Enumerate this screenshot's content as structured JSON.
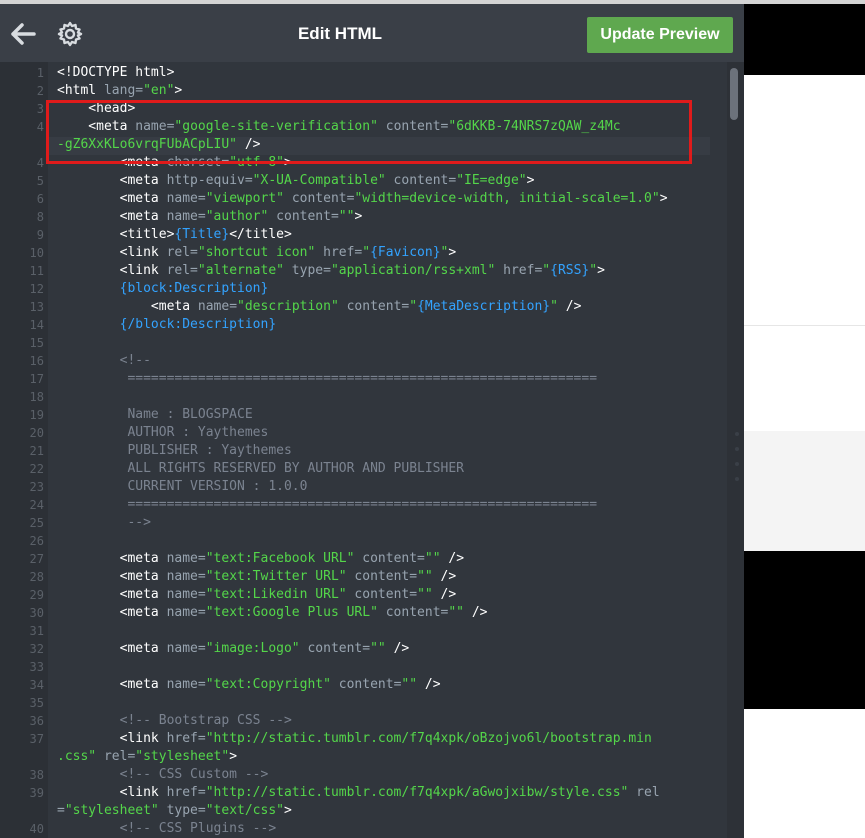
{
  "header": {
    "title": "Edit HTML",
    "update_button_label": "Update Preview",
    "back_icon": "left-arrow-icon",
    "settings_icon": "gear-icon"
  },
  "colors": {
    "editor_bg": "#3a3f47",
    "code_bg": "#31363d",
    "tag": "#ffffff",
    "attr": "#98a4b0",
    "string": "#54d64a",
    "placeholder": "#33a3ff",
    "comment": "#7b8390",
    "button_green": "#5fa84f",
    "highlight_red": "#e01b1b"
  },
  "editor": {
    "lines": [
      {
        "n": "1",
        "tokens": [
          [
            "t",
            "<!DOCTYPE html>"
          ]
        ]
      },
      {
        "n": "2",
        "tokens": [
          [
            "t",
            "<html "
          ],
          [
            "a",
            "lang="
          ],
          [
            "s",
            "\"en\""
          ],
          [
            "t",
            ">"
          ]
        ]
      },
      {
        "n": "3",
        "tokens": [
          [
            "t",
            "    <head>"
          ]
        ]
      },
      {
        "n": "4",
        "tokens": [
          [
            "t",
            "    <meta "
          ],
          [
            "a",
            "name="
          ],
          [
            "s",
            "\"google-site-verification\""
          ],
          [
            "a",
            " content="
          ],
          [
            "s",
            "\"6dKKB-74NRS7zQAW_z4Mc"
          ]
        ]
      },
      {
        "n": "",
        "tokens": [
          [
            "s",
            "-gZ6XxKLo6vrqFUbACpLIU\""
          ],
          [
            "t",
            " />"
          ]
        ]
      },
      {
        "n": "4",
        "tokens": [
          [
            "t",
            "        <meta "
          ],
          [
            "a",
            "charset="
          ],
          [
            "s",
            "\"utf-8\""
          ],
          [
            "t",
            ">"
          ]
        ]
      },
      {
        "n": "5",
        "tokens": [
          [
            "t",
            "        <meta "
          ],
          [
            "a",
            "http-equiv="
          ],
          [
            "s",
            "\"X-UA-Compatible\""
          ],
          [
            "a",
            " content="
          ],
          [
            "s",
            "\"IE=edge\""
          ],
          [
            "t",
            ">"
          ]
        ]
      },
      {
        "n": "6",
        "tokens": [
          [
            "t",
            "        <meta "
          ],
          [
            "a",
            "name="
          ],
          [
            "s",
            "\"viewport\""
          ],
          [
            "a",
            " content="
          ],
          [
            "s",
            "\"width=device-width, initial-scale=1.0\""
          ],
          [
            "t",
            ">"
          ]
        ]
      },
      {
        "n": "8",
        "tokens": [
          [
            "t",
            "        <meta "
          ],
          [
            "a",
            "name="
          ],
          [
            "s",
            "\"author\""
          ],
          [
            "a",
            " content="
          ],
          [
            "s",
            "\"\""
          ],
          [
            "t",
            ">"
          ]
        ]
      },
      {
        "n": "9",
        "tokens": [
          [
            "t",
            "        <title>"
          ],
          [
            "p",
            "{Title}"
          ],
          [
            "t",
            "</title>"
          ]
        ]
      },
      {
        "n": "10",
        "tokens": [
          [
            "t",
            "        <link "
          ],
          [
            "a",
            "rel="
          ],
          [
            "s",
            "\"shortcut icon\""
          ],
          [
            "a",
            " href="
          ],
          [
            "s",
            "\""
          ],
          [
            "p",
            "{Favicon}"
          ],
          [
            "s",
            "\""
          ],
          [
            "t",
            ">"
          ]
        ]
      },
      {
        "n": "11",
        "tokens": [
          [
            "t",
            "        <link "
          ],
          [
            "a",
            "rel="
          ],
          [
            "s",
            "\"alternate\""
          ],
          [
            "a",
            " type="
          ],
          [
            "s",
            "\"application/rss+xml\""
          ],
          [
            "a",
            " href="
          ],
          [
            "s",
            "\""
          ],
          [
            "p",
            "{RSS}"
          ],
          [
            "s",
            "\""
          ],
          [
            "t",
            ">"
          ]
        ]
      },
      {
        "n": "12",
        "tokens": [
          [
            "p",
            "        {block:Description}"
          ]
        ]
      },
      {
        "n": "13",
        "tokens": [
          [
            "t",
            "            <meta "
          ],
          [
            "a",
            "name="
          ],
          [
            "s",
            "\"description\""
          ],
          [
            "a",
            " content="
          ],
          [
            "s",
            "\""
          ],
          [
            "p",
            "{MetaDescription}"
          ],
          [
            "s",
            "\""
          ],
          [
            "t",
            " />"
          ]
        ]
      },
      {
        "n": "14",
        "tokens": [
          [
            "p",
            "        {/block:Description}"
          ]
        ]
      },
      {
        "n": "15",
        "tokens": []
      },
      {
        "n": "16",
        "tokens": [
          [
            "c",
            "        <!--"
          ]
        ]
      },
      {
        "n": "17",
        "tokens": [
          [
            "c",
            "         ============================================================"
          ]
        ]
      },
      {
        "n": "18",
        "tokens": []
      },
      {
        "n": "19",
        "tokens": [
          [
            "c",
            "         Name : BLOGSPACE"
          ]
        ]
      },
      {
        "n": "20",
        "tokens": [
          [
            "c",
            "         AUTHOR : Yaythemes"
          ]
        ]
      },
      {
        "n": "21",
        "tokens": [
          [
            "c",
            "         PUBLISHER : Yaythemes"
          ]
        ]
      },
      {
        "n": "22",
        "tokens": [
          [
            "c",
            "         ALL RIGHTS RESERVED BY AUTHOR AND PUBLISHER"
          ]
        ]
      },
      {
        "n": "23",
        "tokens": [
          [
            "c",
            "         CURRENT VERSION : 1.0.0"
          ]
        ]
      },
      {
        "n": "24",
        "tokens": [
          [
            "c",
            "         ============================================================"
          ]
        ]
      },
      {
        "n": "25",
        "tokens": [
          [
            "c",
            "         -->"
          ]
        ]
      },
      {
        "n": "26",
        "tokens": []
      },
      {
        "n": "27",
        "tokens": [
          [
            "t",
            "        <meta "
          ],
          [
            "a",
            "name="
          ],
          [
            "s",
            "\"text:Facebook URL\""
          ],
          [
            "a",
            " content="
          ],
          [
            "s",
            "\"\""
          ],
          [
            "t",
            " />"
          ]
        ]
      },
      {
        "n": "28",
        "tokens": [
          [
            "t",
            "        <meta "
          ],
          [
            "a",
            "name="
          ],
          [
            "s",
            "\"text:Twitter URL\""
          ],
          [
            "a",
            " content="
          ],
          [
            "s",
            "\"\""
          ],
          [
            "t",
            " />"
          ]
        ]
      },
      {
        "n": "29",
        "tokens": [
          [
            "t",
            "        <meta "
          ],
          [
            "a",
            "name="
          ],
          [
            "s",
            "\"text:Likedin URL\""
          ],
          [
            "a",
            " content="
          ],
          [
            "s",
            "\"\""
          ],
          [
            "t",
            " />"
          ]
        ]
      },
      {
        "n": "30",
        "tokens": [
          [
            "t",
            "        <meta "
          ],
          [
            "a",
            "name="
          ],
          [
            "s",
            "\"text:Google Plus URL\""
          ],
          [
            "a",
            " content="
          ],
          [
            "s",
            "\"\""
          ],
          [
            "t",
            " />"
          ]
        ]
      },
      {
        "n": "31",
        "tokens": []
      },
      {
        "n": "32",
        "tokens": [
          [
            "t",
            "        <meta "
          ],
          [
            "a",
            "name="
          ],
          [
            "s",
            "\"image:Logo\""
          ],
          [
            "a",
            " content="
          ],
          [
            "s",
            "\"\""
          ],
          [
            "t",
            " />"
          ]
        ]
      },
      {
        "n": "33",
        "tokens": []
      },
      {
        "n": "34",
        "tokens": [
          [
            "t",
            "        <meta "
          ],
          [
            "a",
            "name="
          ],
          [
            "s",
            "\"text:Copyright\""
          ],
          [
            "a",
            " content="
          ],
          [
            "s",
            "\"\""
          ],
          [
            "t",
            " />"
          ]
        ]
      },
      {
        "n": "35",
        "tokens": []
      },
      {
        "n": "36",
        "tokens": [
          [
            "c",
            "        <!-- Bootstrap CSS -->"
          ]
        ]
      },
      {
        "n": "37",
        "tokens": [
          [
            "t",
            "        <link "
          ],
          [
            "a",
            "href="
          ],
          [
            "s",
            "\"http://static.tumblr.com/f7q4xpk/oBzojvo6l/bootstrap.min"
          ]
        ]
      },
      {
        "n": "",
        "tokens": [
          [
            "s",
            ".css\""
          ],
          [
            "a",
            " rel="
          ],
          [
            "s",
            "\"stylesheet\""
          ],
          [
            "t",
            ">"
          ]
        ]
      },
      {
        "n": "38",
        "tokens": [
          [
            "c",
            "        <!-- CSS Custom -->"
          ]
        ]
      },
      {
        "n": "39",
        "tokens": [
          [
            "t",
            "        <link "
          ],
          [
            "a",
            "href="
          ],
          [
            "s",
            "\"http://static.tumblr.com/f7q4xpk/aGwojxibw/style.css\""
          ],
          [
            "a",
            " rel"
          ]
        ]
      },
      {
        "n": "",
        "tokens": [
          [
            "a",
            "="
          ],
          [
            "s",
            "\"stylesheet\""
          ],
          [
            "a",
            " type="
          ],
          [
            "s",
            "\"text/css\""
          ],
          [
            "t",
            ">"
          ]
        ]
      },
      {
        "n": "40",
        "tokens": [
          [
            "c",
            "        <!-- CSS Plugins -->"
          ]
        ]
      }
    ]
  }
}
